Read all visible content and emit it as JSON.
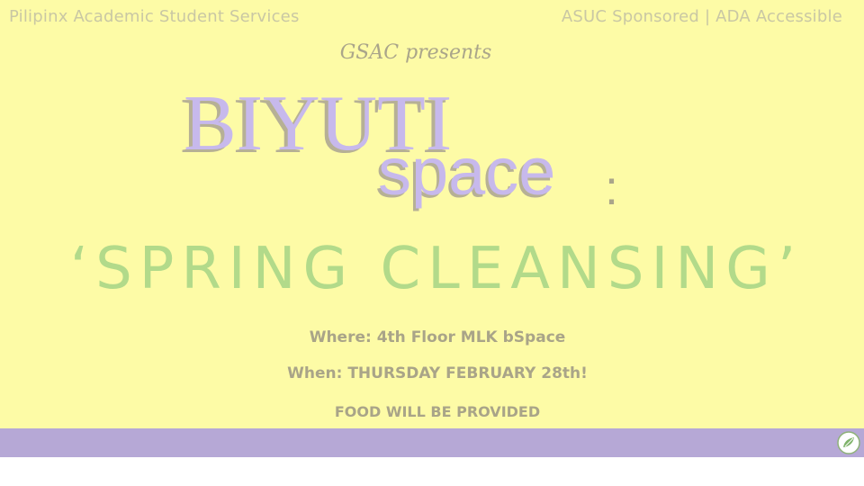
{
  "header": {
    "org": "Pilipinx Academic Student Services",
    "sponsor": "ASUC Sponsored | ADA Accessible"
  },
  "event": {
    "presenter": "GSAC presents",
    "title_line1": "BIYUTI",
    "title_line2": "space",
    "title_colon": ":",
    "subtitle": "‘SPRING CLEANSING’",
    "where": "Where: 4th Floor MLK bSpace",
    "when": "When: THURSDAY FEBRUARY 28th!",
    "food": "FOOD WILL BE PROVIDED"
  },
  "colors": {
    "background": "#fdfba6",
    "footer_band": "#b6a8d6",
    "title_fill": "#c7b9ec",
    "subtitle": "#b2da8a"
  },
  "icons": {
    "footer_logo": "leaf-logo-icon"
  }
}
